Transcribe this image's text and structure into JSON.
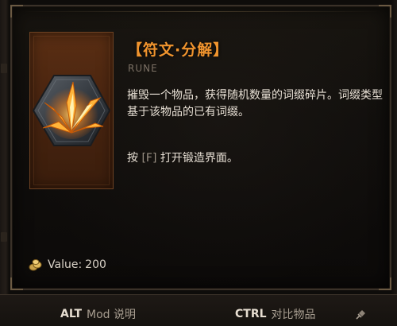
{
  "item": {
    "title": "【符文·分解】",
    "type": "RUNE",
    "description": "摧毁一个物品，获得随机数量的词缀碎片。词缀类型基于该物品的已有词缀。",
    "hint_prefix": "按 ",
    "hint_key": "[F]",
    "hint_suffix": " 打开锻造界面。",
    "icon": "rune-shatter-icon"
  },
  "value": {
    "label": "Value:",
    "amount": "200",
    "icon": "gold-coins-icon"
  },
  "footer": {
    "alt_key": "ALT",
    "alt_action": "Mod 说明",
    "ctrl_key": "CTRL",
    "ctrl_action": "对比物品",
    "pin_icon": "pin-icon"
  },
  "colors": {
    "title": "#f0942e",
    "card_bg": "#4a2510",
    "panel_bg": "#100e0c",
    "text": "#e9e1d6"
  }
}
